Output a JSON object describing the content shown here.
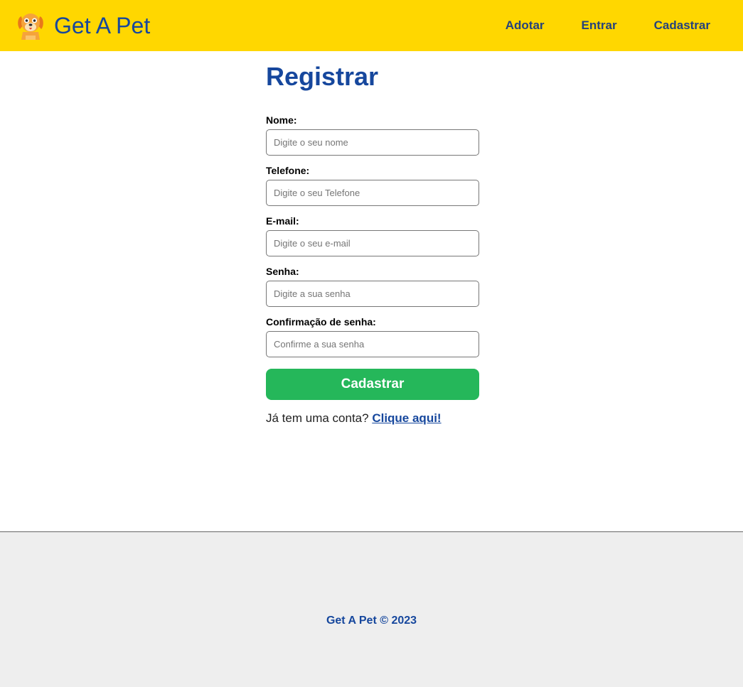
{
  "navbar": {
    "brand_name": "Get A Pet",
    "logo_icon": "dog-icon",
    "links": [
      {
        "label": "Adotar"
      },
      {
        "label": "Entrar"
      },
      {
        "label": "Cadastrar"
      }
    ]
  },
  "main": {
    "title": "Registrar",
    "fields": [
      {
        "label": "Nome:",
        "placeholder": "Digite o seu nome",
        "value": ""
      },
      {
        "label": "Telefone:",
        "placeholder": "Digite o seu Telefone",
        "value": ""
      },
      {
        "label": "E-mail:",
        "placeholder": "Digite o seu e-mail",
        "value": ""
      },
      {
        "label": "Senha:",
        "placeholder": "Digite a sua senha",
        "value": ""
      },
      {
        "label": "Confirmação de senha:",
        "placeholder": "Confirme a sua senha",
        "value": ""
      }
    ],
    "submit_label": "Cadastrar",
    "login_prompt": "Já tem uma conta?",
    "login_link": "Clique aqui!"
  },
  "footer": {
    "text": "Get A Pet © 2023"
  },
  "colors": {
    "navbar_bg": "#ffd700",
    "brand_blue": "#16479d",
    "submit_green": "#25b75a",
    "footer_bg": "#eeeeee"
  }
}
